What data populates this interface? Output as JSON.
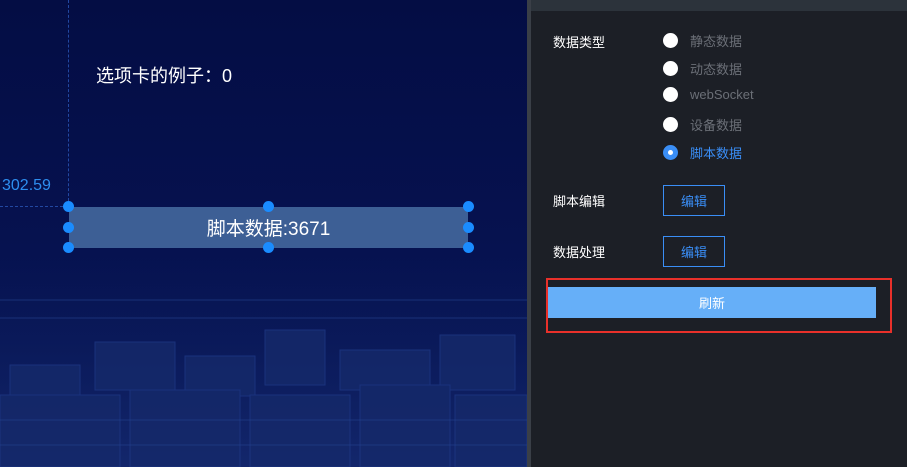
{
  "canvas": {
    "coordinate_readout": "302.59",
    "tab_example_text": "选项卡的例子：0",
    "selected_component_text": "脚本数据:3671"
  },
  "panel": {
    "data_type_label": "数据类型",
    "data_type_options": [
      {
        "label": "静态数据",
        "checked": false
      },
      {
        "label": "动态数据",
        "checked": false
      },
      {
        "label": "webSocket",
        "checked": false
      },
      {
        "label": "设备数据",
        "checked": false
      },
      {
        "label": "脚本数据",
        "checked": true
      }
    ],
    "script_edit_label": "脚本编辑",
    "script_edit_button": "编辑",
    "data_process_label": "数据处理",
    "data_process_button": "编辑",
    "refresh_button": "刷新"
  },
  "colors": {
    "accent": "#3a8ef6",
    "refresh_button": "#66aff8",
    "highlight_outline": "#e8302a",
    "selection_handle": "#1a8cff",
    "panel_bg": "#1c1f26",
    "canvas_bg": "#061250"
  }
}
